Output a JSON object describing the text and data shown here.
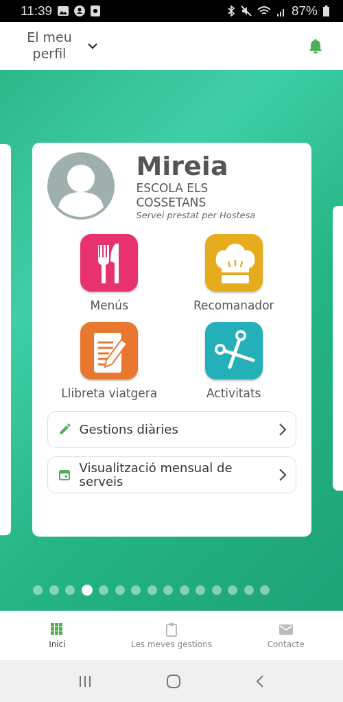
{
  "status_bar": {
    "time": "11:39",
    "battery": "87%"
  },
  "header": {
    "title": "El meu perfil"
  },
  "profile": {
    "name": "Mireia",
    "school": "ESCOLA ELS COSSETANS",
    "provider": "Servei prestat per Hostesa"
  },
  "tiles": [
    {
      "label": "Menús",
      "kind": "cutlery",
      "color": "#e8326f"
    },
    {
      "label": "Recomanador",
      "kind": "chef",
      "color": "#e6ac1e"
    },
    {
      "label": "Llibreta viatgera",
      "kind": "notepad",
      "color": "#e97730"
    },
    {
      "label": "Activitats",
      "kind": "scissors",
      "color": "#23b0b9"
    }
  ],
  "actions": [
    {
      "label": "Gestions diàries",
      "kind": "pencil"
    },
    {
      "label": "Visualització mensual de serveis",
      "kind": "calendar"
    }
  ],
  "pager": [
    {
      "selected": false
    },
    {
      "selected": false
    },
    {
      "selected": false
    },
    {
      "selected": true
    },
    {
      "selected": false
    },
    {
      "selected": false
    },
    {
      "selected": false
    },
    {
      "selected": false
    },
    {
      "selected": false
    },
    {
      "selected": false
    },
    {
      "selected": false
    },
    {
      "selected": false
    },
    {
      "selected": false
    },
    {
      "selected": false
    },
    {
      "selected": false
    }
  ],
  "bottom_nav": [
    {
      "label": "Inici",
      "kind": "grid",
      "selected": true
    },
    {
      "label": "Les meves gestions",
      "kind": "clipboard",
      "selected": false
    },
    {
      "label": "Contacte",
      "kind": "mail",
      "selected": false
    }
  ]
}
